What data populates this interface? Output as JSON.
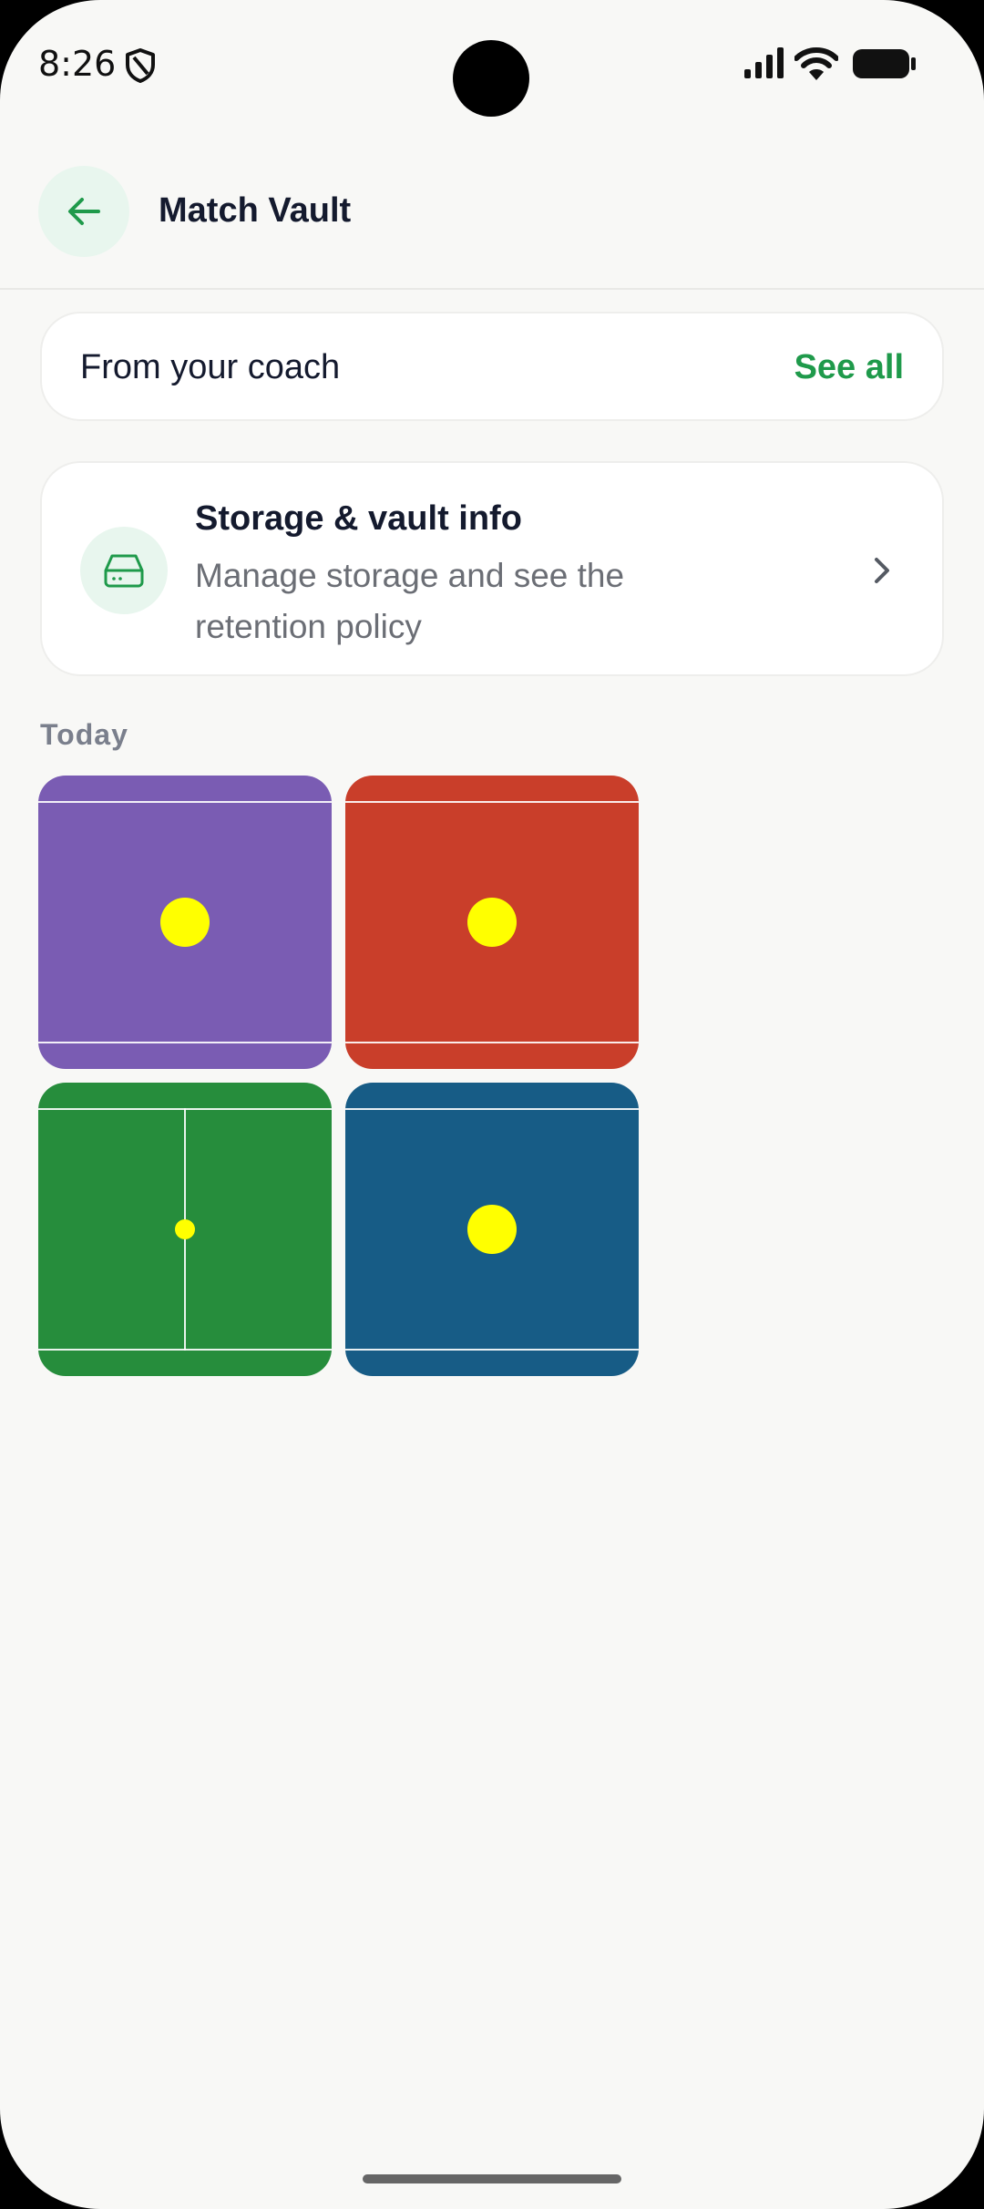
{
  "status_bar": {
    "time": "8:26",
    "icons": [
      "shield-icon",
      "signal-icon",
      "wifi-icon",
      "battery-icon"
    ]
  },
  "app_bar": {
    "title": "Match Vault",
    "back_icon": "arrow-left-icon"
  },
  "coach_card": {
    "title": "From your coach",
    "action_label": "See all"
  },
  "storage_card": {
    "title": "Storage & vault info",
    "subtitle": "Manage storage and see the retention policy",
    "icon": "storage-drive-icon"
  },
  "section": {
    "title": "Today"
  },
  "match_tiles": [
    {
      "color": "#7a5cb3",
      "ball": "large",
      "center_line": false
    },
    {
      "color": "#c93e2a",
      "ball": "large",
      "center_line": false
    },
    {
      "color": "#268d3c",
      "ball": "small",
      "center_line": true
    },
    {
      "color": "#175c86",
      "ball": "large",
      "center_line": false
    }
  ],
  "colors": {
    "accent": "#1f9a4b",
    "accent_soft": "#e8f6ee",
    "background": "#f8f8f6",
    "ball": "#ffff00",
    "text_primary": "#141a2e",
    "text_secondary": "#6b6e75"
  }
}
